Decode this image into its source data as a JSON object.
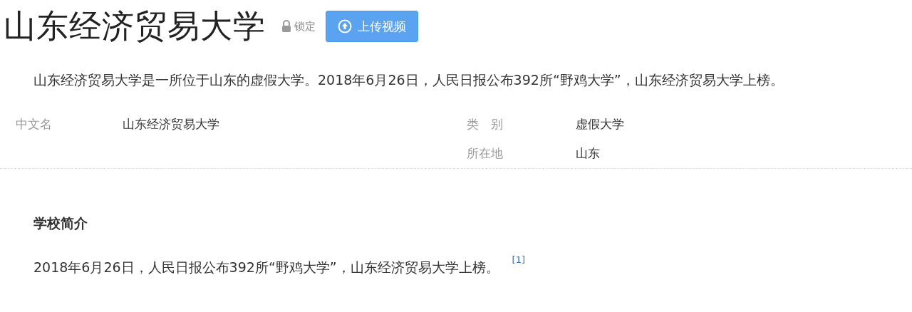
{
  "title": "山东经济贸易大学",
  "lock_label": "锁定",
  "upload_button": "上传视频",
  "summary": "山东经济贸易大学是一所位于山东的虚假大学。2018年6月26日，人民日报公布392所“野鸡大学”，山东经济贸易大学上榜。",
  "basic_info": {
    "left": [
      {
        "label": "中文名",
        "value": "山东经济贸易大学"
      }
    ],
    "right": [
      {
        "label": "类　别",
        "value": "虚假大学"
      },
      {
        "label": "所在地",
        "value": "山东"
      }
    ]
  },
  "section": {
    "heading": "学校简介",
    "text": "2018年6月26日，人民日报公布392所“野鸡大学”，山东经济贸易大学上榜。",
    "reference": "[1]"
  }
}
